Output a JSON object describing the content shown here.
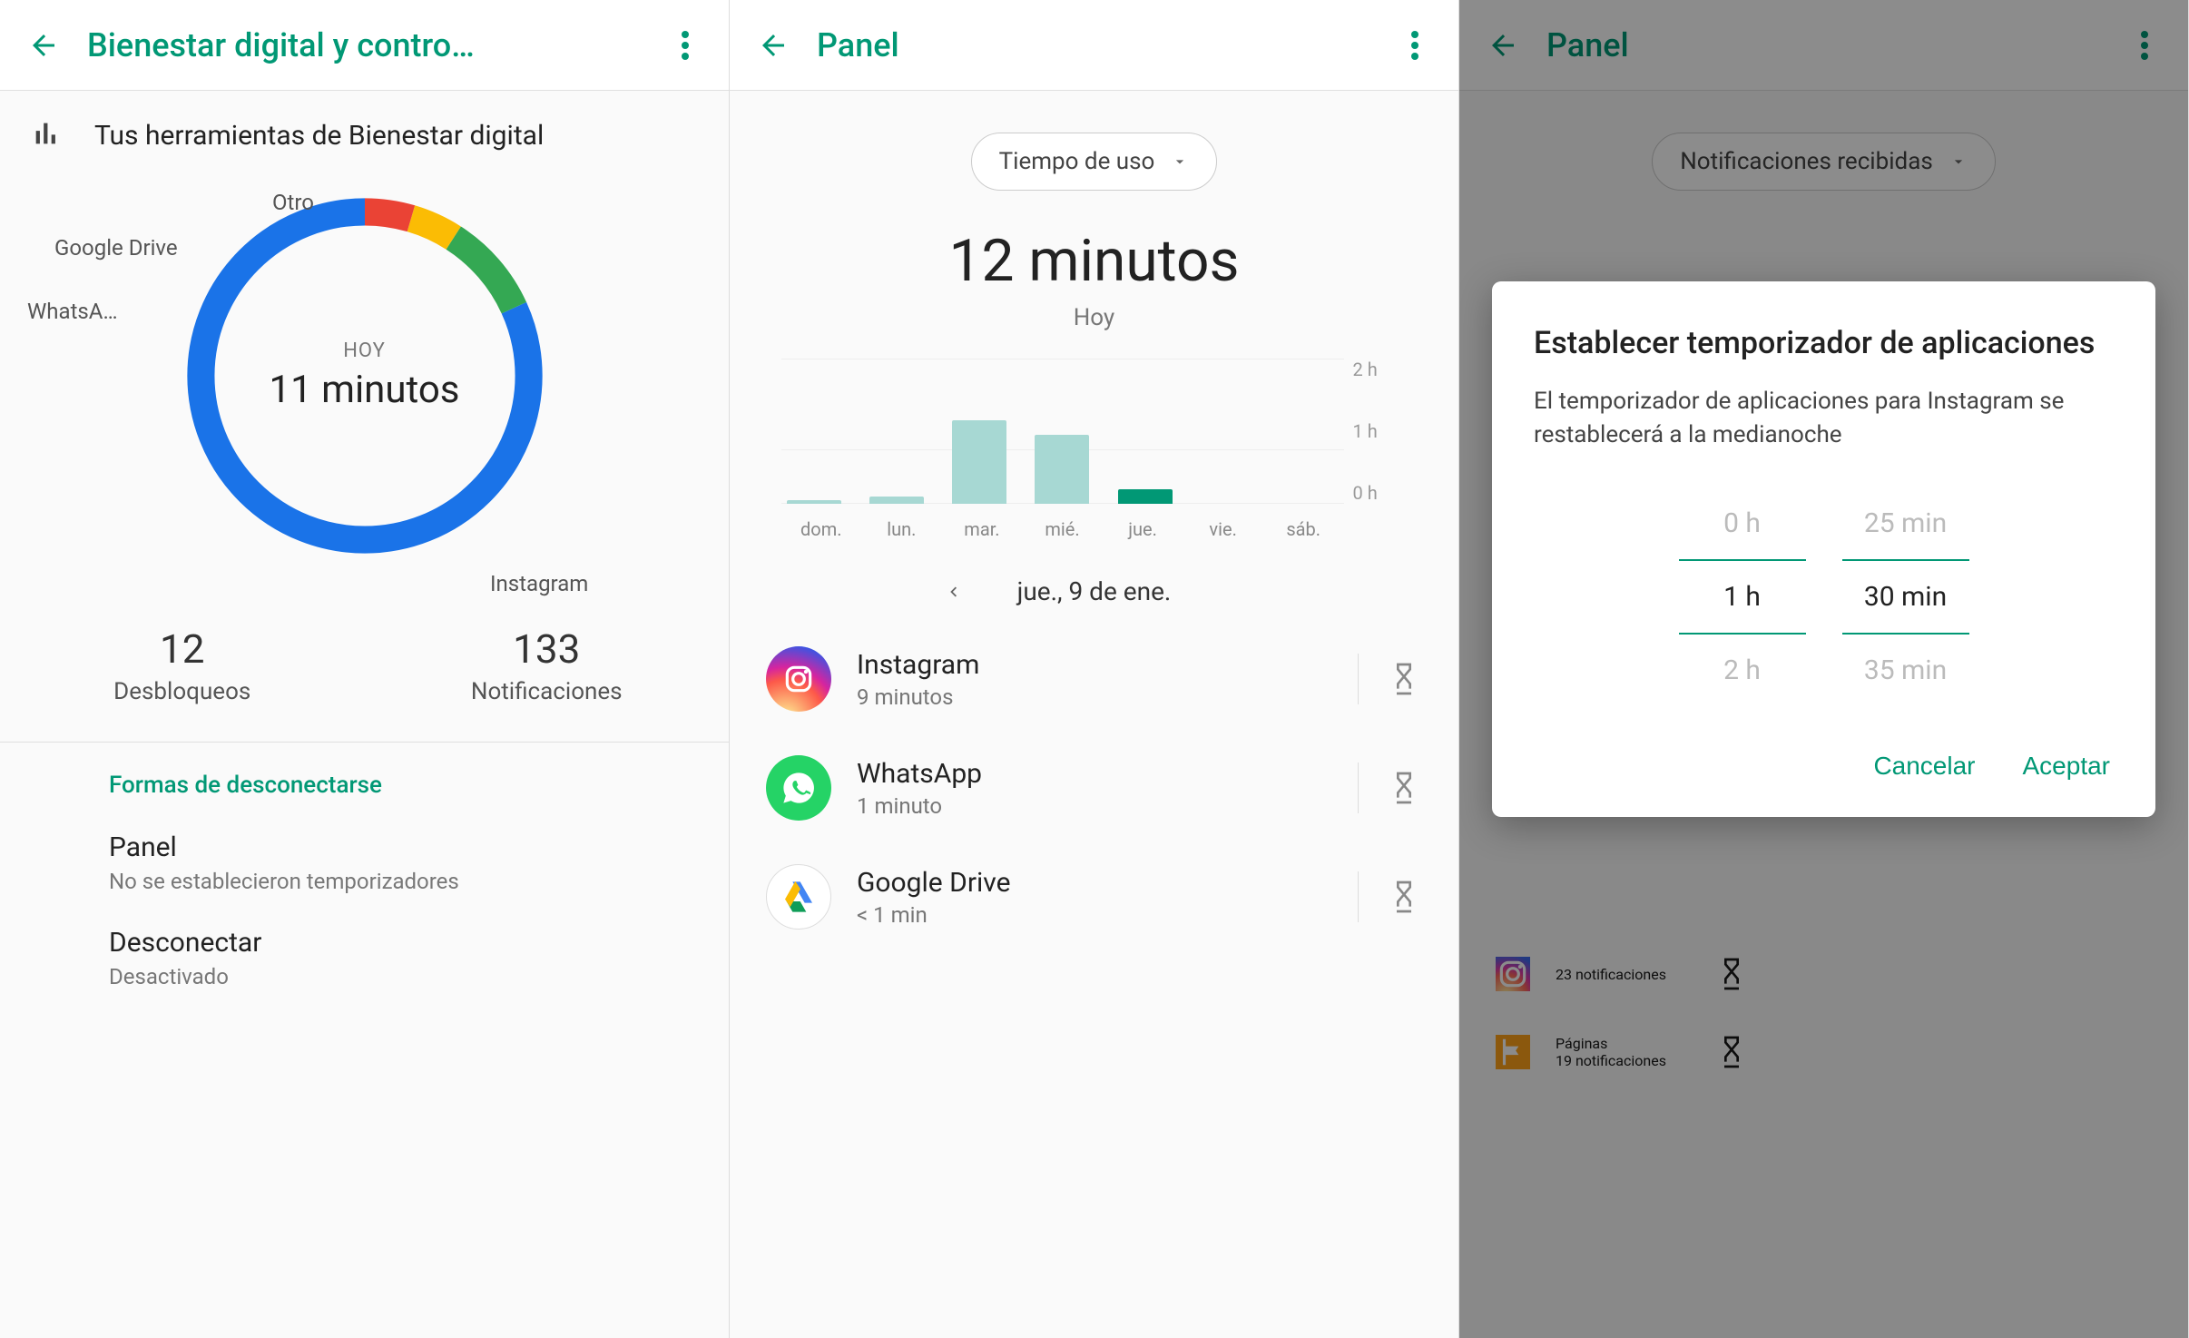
{
  "colors": {
    "accent": "#019875"
  },
  "screen1": {
    "title": "Bienestar digital y contro…",
    "heading": "Tus herramientas de Bienestar digital",
    "donut": {
      "today_label": "HOY",
      "today_value": "11 minutos",
      "labels": {
        "otro": "Otro",
        "drive": "Google Drive",
        "whatsapp": "WhatsA…",
        "instagram": "Instagram"
      }
    },
    "stats": {
      "unlocks_value": "12",
      "unlocks_label": "Desbloqueos",
      "notifs_value": "133",
      "notifs_label": "Notificaciones"
    },
    "disconnect_header": "Formas de desconectarse",
    "panel": {
      "title": "Panel",
      "subtitle": "No se establecieron temporizadores"
    },
    "disconnect_item": {
      "title": "Desconectar",
      "subtitle": "Desactivado"
    }
  },
  "screen2": {
    "title": "Panel",
    "chip": "Tiempo de uso",
    "total_time": "12 minutos",
    "today": "Hoy",
    "date": "jue., 9 de ene.",
    "y_ticks": [
      "2 h",
      "1 h",
      "0 h"
    ],
    "days": [
      "dom.",
      "lun.",
      "mar.",
      "mié.",
      "jue.",
      "vie.",
      "sáb."
    ],
    "apps": [
      {
        "name": "Instagram",
        "detail": "9 minutos"
      },
      {
        "name": "WhatsApp",
        "detail": "1 minuto"
      },
      {
        "name": "Google Drive",
        "detail": "< 1 min"
      }
    ]
  },
  "screen3": {
    "title": "Panel",
    "chip": "Notificaciones recibidas",
    "dialog": {
      "title": "Establecer temporizador de aplicaciones",
      "body": "El temporizador de aplicaciones para Instagram se restablecerá a la medianoche",
      "hours": [
        "0 h",
        "1 h",
        "2 h"
      ],
      "mins": [
        "25 min",
        "30 min",
        "35 min"
      ],
      "cancel": "Cancelar",
      "accept": "Aceptar"
    },
    "bg_rows": [
      {
        "detail": "23 notificaciones"
      },
      {
        "name": "Páginas",
        "detail": "19 notificaciones"
      }
    ]
  },
  "chart_data": [
    {
      "type": "donut",
      "title": "HOY 11 minutos",
      "series": [
        {
          "name": "Instagram",
          "value": 9,
          "color": "#1a73e8"
        },
        {
          "name": "Otro",
          "value": 1,
          "color": "#34a853"
        },
        {
          "name": "Google Drive",
          "value": 0.5,
          "color": "#fbbc04"
        },
        {
          "name": "WhatsA…",
          "value": 0.5,
          "color": "#ea4335"
        }
      ],
      "unit": "minutos"
    },
    {
      "type": "bar",
      "title": "Tiempo de uso — Hoy 12 minutos",
      "categories": [
        "dom.",
        "lun.",
        "mar.",
        "mié.",
        "jue.",
        "vie.",
        "sáb."
      ],
      "values": [
        0.05,
        0.1,
        1.15,
        0.95,
        0.2,
        0,
        0
      ],
      "selected_index": 4,
      "ylabel": "horas",
      "ylim": [
        0,
        2
      ],
      "y_ticks": [
        0,
        1,
        2
      ]
    }
  ]
}
